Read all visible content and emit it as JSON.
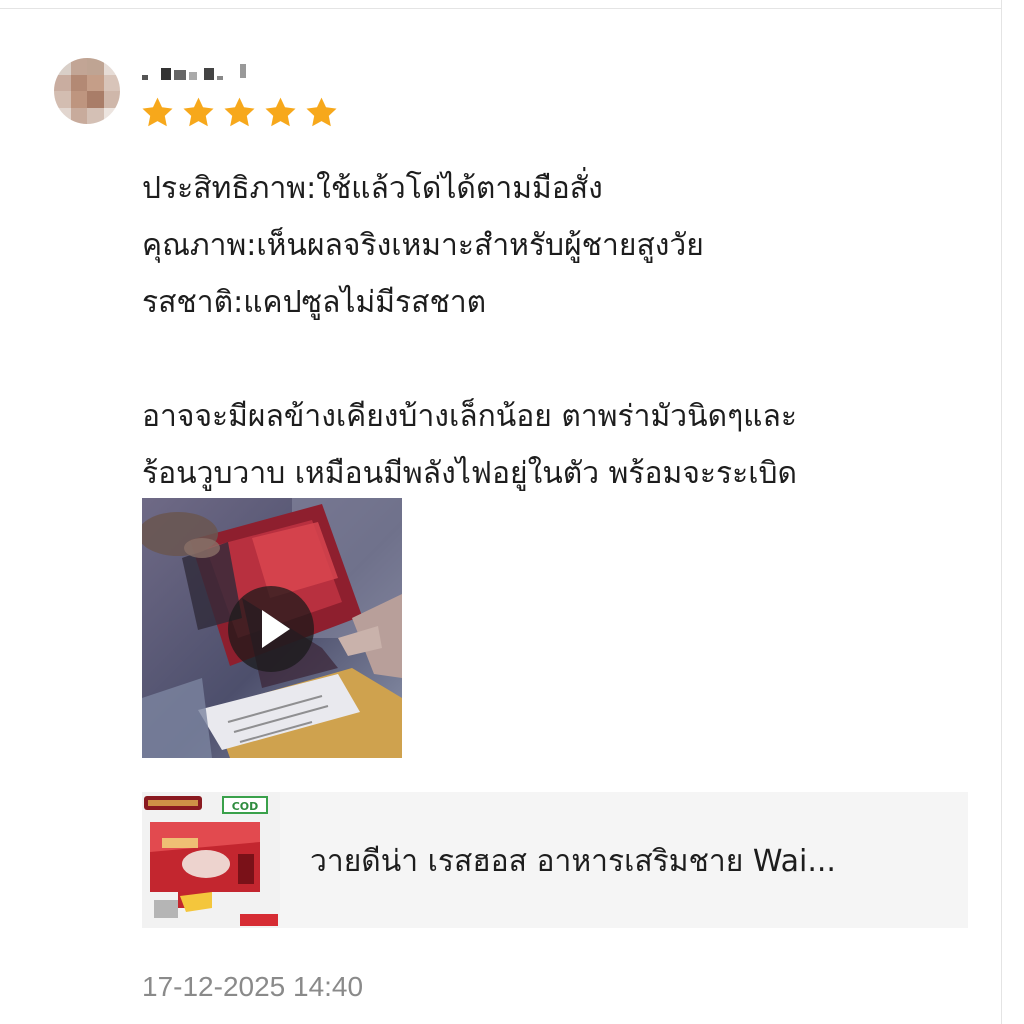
{
  "review": {
    "user": {
      "avatar_icon": "user-avatar-pixelated",
      "name_obscured": true
    },
    "rating": {
      "value": 5,
      "max": 5,
      "star_color": "#f7a81b"
    },
    "lines": [
      "ประสิทธิภาพ:ใช้แล้วโด่ได้ตามมือสั่ง",
      "คุณภาพ:เห็นผลจริงเหมาะสำหรับผู้ชายสูงวัย",
      "รสชาติ:แคปซูลไม่มีรสชาต"
    ],
    "comment_lines": [
      "อาจจะมีผลข้างเคียงบ้างเล็กน้อย ตาพร่ามัวนิดๆและ",
      "ร้อนวูบวาบ เหมือนมีพลังไฟอยู่ในตัว พร้อมจะระเบิด"
    ],
    "video": {
      "play_icon": "play-icon"
    },
    "product": {
      "title": "วายดีน่า เรสฮอส อาหารเสริมชาย Wai...",
      "badge": "COD"
    },
    "timestamp": "17-12-2025 14:40"
  }
}
